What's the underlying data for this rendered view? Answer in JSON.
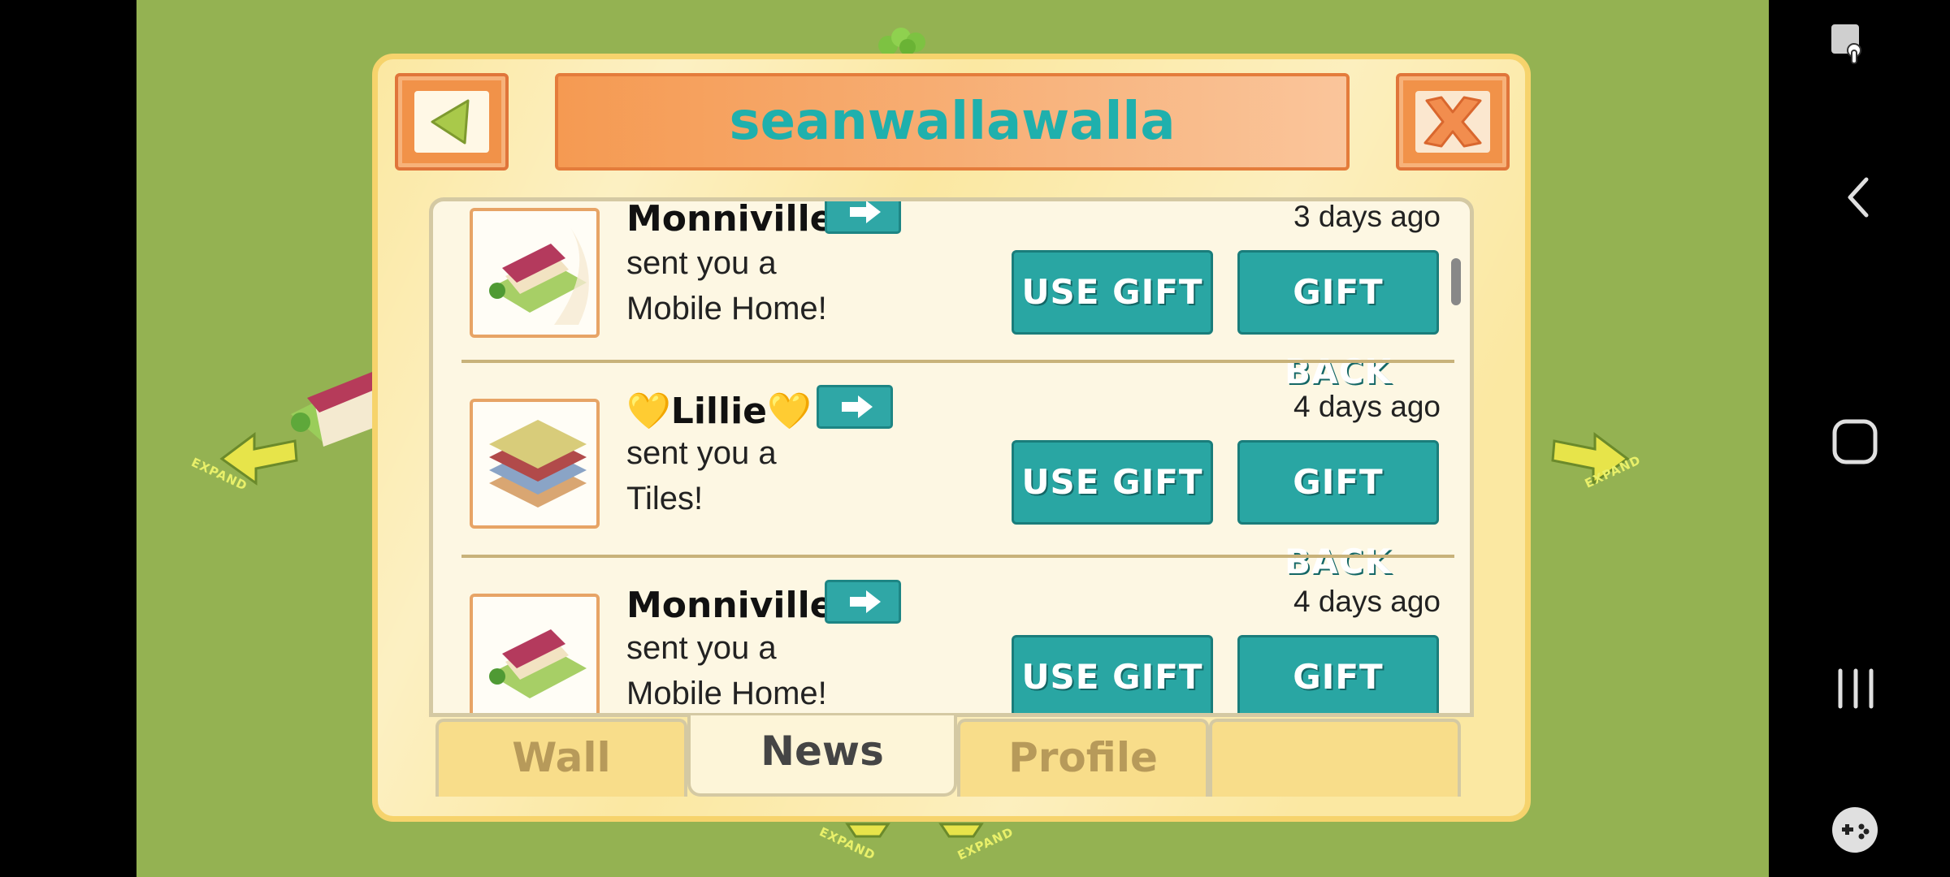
{
  "dialog": {
    "title": "seanwallawalla"
  },
  "feed": [
    {
      "sender": "Monniville",
      "message": "sent you a\nMobile Home!",
      "time": "3 days ago",
      "item_icon": "mobile-home-icon",
      "use_label": "USE GIFT",
      "gift_back_label": "GIFT BACK"
    },
    {
      "sender": "💛Lillie💛",
      "message": "sent you a\nTiles!",
      "time": "4 days ago",
      "item_icon": "tiles-icon",
      "use_label": "USE GIFT",
      "gift_back_label": "GIFT BACK"
    },
    {
      "sender": "Monniville",
      "message": "sent you a\nMobile Home!",
      "time": "4 days ago",
      "item_icon": "mobile-home-icon",
      "use_label": "USE GIFT",
      "gift_back_label": "GIFT BACK"
    }
  ],
  "tabs": [
    {
      "label": "Wall",
      "active": false
    },
    {
      "label": "News",
      "active": true
    },
    {
      "label": "Profile",
      "active": false
    }
  ],
  "background": {
    "expand_label": "EXPAND"
  },
  "colors": {
    "accent_teal": "#29a6a3",
    "frame_yellow": "#fbe8a2",
    "title_orange": "#f7a463",
    "grass": "#94b252"
  },
  "system_nav": {
    "icons": [
      "screen-pin-icon",
      "back-icon",
      "home-icon",
      "recents-icon",
      "game-tools-icon"
    ]
  }
}
